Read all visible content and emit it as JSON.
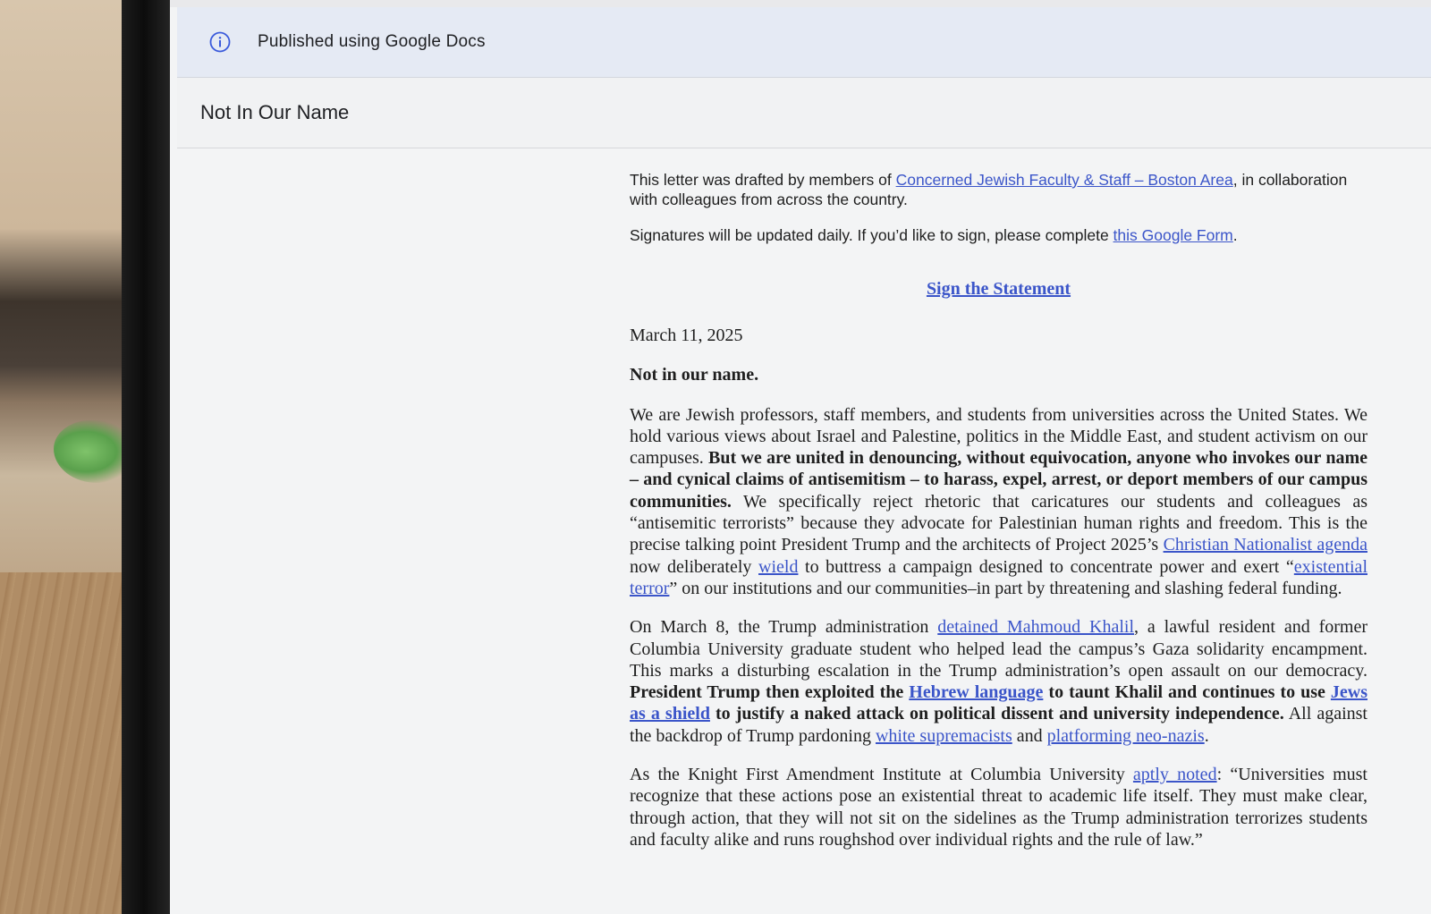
{
  "banner": {
    "icon": "info-icon",
    "text": "Published using Google Docs"
  },
  "doc": {
    "title": "Not In Our Name"
  },
  "intro": {
    "p1_a": "This letter was drafted by members of ",
    "p1_link": "Concerned Jewish Faculty & Staff – Boston Area",
    "p1_b": ", in collaboration with colleagues from across the country.",
    "p2_a": "Signatures will be updated daily. If you’d like to sign, please complete ",
    "p2_link": "this Google Form",
    "p2_b": "."
  },
  "sign_link": "Sign the Statement",
  "date": "March 11, 2025",
  "lead": "Not in our name.",
  "para1": {
    "t1": "We are Jewish professors, staff members, and students from universities across the United States. We hold various views about Israel and Palestine, politics in the Middle East, and student activism on our campuses. ",
    "b1": "But we are united in denouncing, without equivocation, anyone who invokes our name – and cynical claims of antisemitism – to harass, expel, arrest, or deport members of our campus communities.",
    "t2": " We specifically reject rhetoric that caricatures our students and colleagues as “antisemitic terrorists” because they advocate for Palestinian human rights and freedom. This is the precise talking point President Trump and the architects of Project 2025’s ",
    "l1": "Christian Nationalist agenda",
    "t3": " now deliberately ",
    "l2": "wield",
    "t4": " to buttress a campaign designed to concentrate power and exert “",
    "l3": "existential terror",
    "t5": "” on our institutions and our communities–in part by threatening and slashing federal funding."
  },
  "para2": {
    "t1": "On March 8, the Trump administration ",
    "l1": "detained Mahmoud Khalil",
    "t2": ", a lawful resident and former Columbia University graduate student who helped lead the campus’s Gaza solidarity encampment. This marks a disturbing escalation in the Trump administration’s open assault on our democracy. ",
    "b1": "President Trump then exploited the ",
    "bl1": "Hebrew language",
    "b2": " to taunt Khalil and continues to use ",
    "bl2": "Jews as a shield",
    "b3": " to justify a naked attack on political dissent and university independence.",
    "t3": " All against the backdrop of Trump pardoning ",
    "l2": "white supremacists",
    "t4": " and ",
    "l3": "platforming neo-nazis",
    "t5": "."
  },
  "para3": {
    "t1": "As the Knight First Amendment Institute at Columbia University ",
    "l1": "aptly noted",
    "t2": ": “Universities must recognize that these actions pose an existential threat to academic life itself. They must make clear, through action, that they will not sit on the sidelines as the Trump administration terrorizes students and faculty alike and runs roughshod over individual rights and the rule of law.”"
  },
  "colors": {
    "link": "#3b55c9",
    "banner_bg": "#e5eaf4",
    "icon": "#3b5bdb"
  }
}
